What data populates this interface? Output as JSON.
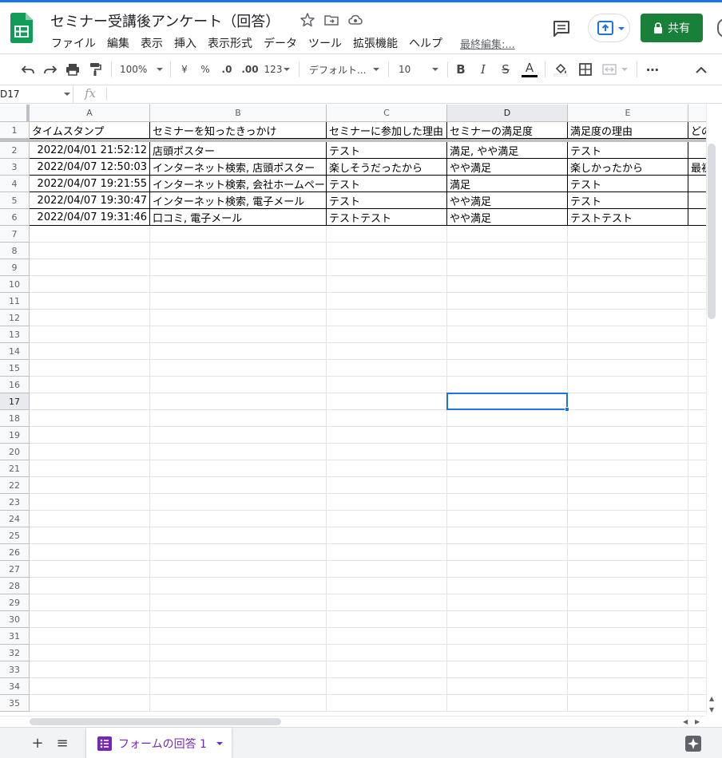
{
  "app": {
    "doc_title": "セミナー受講後アンケート（回答）",
    "menu": [
      "ファイル",
      "編集",
      "表示",
      "挿入",
      "表示形式",
      "データ",
      "ツール",
      "拡張機能",
      "ヘルプ"
    ],
    "last_edit": "最終編集:...",
    "share_label": "共有",
    "brand_color": "#0f9d58",
    "share_color": "#188038",
    "accent_color": "#1a73e8"
  },
  "toolbar": {
    "zoom": "100%",
    "currency": "¥",
    "percent": "%",
    "decimal_decrease": ".0",
    "decimal_increase": ".00",
    "number_format": "123",
    "font": "デフォルト...",
    "font_size": "10",
    "bold": "B",
    "italic": "I",
    "strike": "S",
    "text_color": "A",
    "more": "⋯"
  },
  "formula_bar": {
    "name_box": "D17",
    "fx": "fx",
    "value": ""
  },
  "grid": {
    "columns": [
      "A",
      "B",
      "C",
      "D",
      "E"
    ],
    "active_column": "D",
    "active_row": 17,
    "rows_visible": 35,
    "header_row": [
      "タイムスタンプ",
      "セミナーを知ったきっかけ",
      "セミナーに参加した理由",
      "セミナーの満足度",
      "満足度の理由",
      "どの"
    ],
    "rows": [
      [
        "2022/04/01 21:52:12",
        "店頭ポスター",
        "テスト",
        "満足, やや満足",
        "テスト",
        ""
      ],
      [
        "2022/04/07 12:50:03",
        "インターネット検索, 店頭ポスター",
        "楽しそうだったから",
        "やや満足",
        "楽しかったから",
        "最初"
      ],
      [
        "2022/04/07 19:21:55",
        "インターネット検索, 会社ホームページ",
        "テスト",
        "満足",
        "テスト",
        ""
      ],
      [
        "2022/04/07 19:30:47",
        "インターネット検索, 電子メール",
        "テスト",
        "やや満足",
        "テスト",
        ""
      ],
      [
        "2022/04/07 19:31:46",
        "口コミ, 電子メール",
        "テストテスト",
        "やや満足",
        "テストテスト",
        ""
      ]
    ]
  },
  "sheets": {
    "add_icon": "+",
    "list_icon": "≡",
    "active_tab": "フォームの回答 1"
  },
  "icons": [
    "sheets-logo-icon",
    "star-icon",
    "move-folder-icon",
    "cloud-status-icon",
    "comment-icon",
    "present-icon",
    "lock-icon",
    "undo-icon",
    "redo-icon",
    "print-icon",
    "paint-format-icon",
    "fill-color-icon",
    "borders-icon",
    "merge-icon",
    "collapse-icon",
    "explore-icon"
  ]
}
